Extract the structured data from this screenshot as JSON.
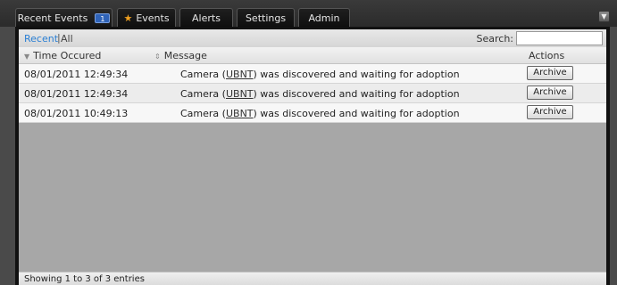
{
  "tabs": [
    {
      "label": "Recent Events",
      "badge": "1"
    },
    {
      "label": "Events"
    },
    {
      "label": "Alerts"
    },
    {
      "label": "Settings"
    },
    {
      "label": "Admin"
    }
  ],
  "filter": {
    "recent": "Recent",
    "separator": "|",
    "all": "All"
  },
  "search": {
    "label": "Search:",
    "value": ""
  },
  "table": {
    "headers": {
      "time": "Time Occured",
      "message": "Message",
      "actions": "Actions"
    },
    "rows": [
      {
        "time": "08/01/2011 12:49:34",
        "msg_pre": "Camera (",
        "msg_link": "UBNT",
        "msg_post": ") was discovered and waiting for adoption",
        "action": "Archive"
      },
      {
        "time": "08/01/2011 12:49:34",
        "msg_pre": "Camera (",
        "msg_link": "UBNT",
        "msg_post": ") was discovered and waiting for adoption",
        "action": "Archive"
      },
      {
        "time": "08/01/2011 10:49:13",
        "msg_pre": "Camera (",
        "msg_link": "UBNT",
        "msg_post": ") was discovered and waiting for adoption",
        "action": "Archive"
      }
    ]
  },
  "footer": {
    "info": "Showing 1 to 3 of 3 entries"
  },
  "icons": {
    "star": "star-icon",
    "collapse": "chevron-down-icon",
    "sort": "sort-icon"
  },
  "colors": {
    "accent": "#2a7fd4",
    "badge": "#2f63b8",
    "star": "#f0a020"
  }
}
